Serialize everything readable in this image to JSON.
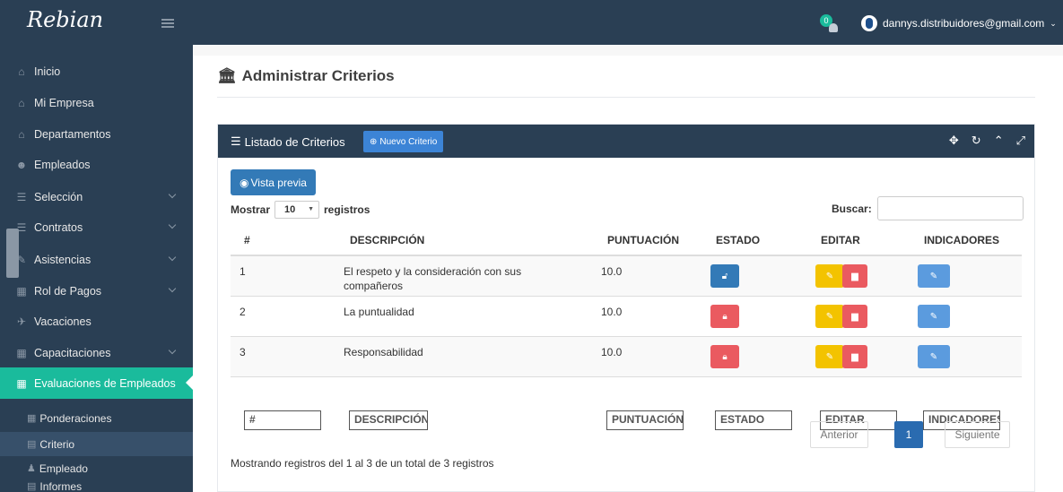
{
  "app": {
    "brand": "Rebian",
    "notif_count": "0",
    "user_email": "dannys.distribuidores@gmail.com"
  },
  "sidebar": {
    "items": [
      {
        "label": "Inicio",
        "icon": "home-icon"
      },
      {
        "label": "Mi Empresa",
        "icon": "institution-icon"
      },
      {
        "label": "Departamentos",
        "icon": "institution-icon"
      },
      {
        "label": "Empleados",
        "icon": "users-icon"
      },
      {
        "label": "Selección",
        "icon": "list-icon"
      },
      {
        "label": "Contratos",
        "icon": "list-icon"
      },
      {
        "label": "Asistencias",
        "icon": "pencil-icon"
      },
      {
        "label": "Rol de Pagos",
        "icon": "table-icon"
      },
      {
        "label": "Vacaciones",
        "icon": "plane-icon"
      },
      {
        "label": "Capacitaciones",
        "icon": "table-icon"
      },
      {
        "label": "Evaluaciones de Empleados",
        "icon": "table-icon"
      }
    ],
    "subitems": [
      {
        "label": "Ponderaciones"
      },
      {
        "label": "Criterio"
      },
      {
        "label": "Empleado"
      },
      {
        "label": "Informes"
      }
    ]
  },
  "page": {
    "title": "Administrar Criterios"
  },
  "panel": {
    "title": "Listado de Criterios",
    "new_button": "Nuevo Criterio",
    "preview_button": "Vista previa",
    "show_label": "Mostrar",
    "show_value": "10",
    "records_label": "registros",
    "search_label": "Buscar:"
  },
  "table": {
    "headers": [
      "#",
      "DESCRIPCIÓN",
      "PUNTUACIÓN",
      "ESTADO",
      "EDITAR",
      "INDICADORES"
    ],
    "rows": [
      {
        "num": "1",
        "desc_l1": "El respeto y la consideración con sus",
        "desc_l2": "compañeros",
        "score": "10.0",
        "estado": "unlocked"
      },
      {
        "num": "2",
        "desc_l1": "La puntualidad",
        "desc_l2": "",
        "score": "10.0",
        "estado": "locked"
      },
      {
        "num": "3",
        "desc_l1": "Responsabilidad",
        "desc_l2": "",
        "score": "10.0",
        "estado": "locked"
      }
    ],
    "footer_inputs": [
      "#",
      "DESCRIPCIÓN",
      "PUNTUACIÓN",
      "ESTADO",
      "EDITAR",
      "INDICADORES"
    ]
  },
  "info": "Mostrando registros del 1 al 3 de un total de 3 registros",
  "pagination": {
    "prev": "Anterior",
    "page": "1",
    "next": "Siguiente"
  },
  "colors": {
    "sidebar_bg": "#2a3f54",
    "accent": "#1abb9c",
    "primary": "#337ab7",
    "danger": "#ea5a60",
    "warning": "#f3c300"
  }
}
